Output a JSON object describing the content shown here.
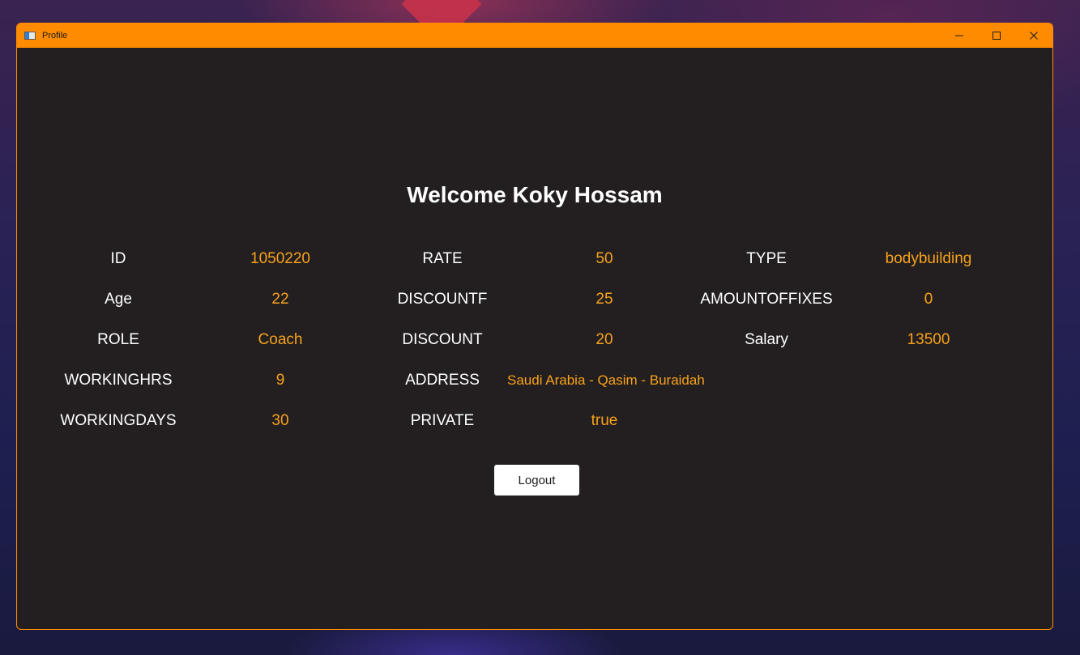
{
  "window": {
    "title": "Profile",
    "controls": {
      "minimize_icon": "minimize-icon",
      "maximize_icon": "maximize-icon",
      "close_icon": "close-icon"
    },
    "accent_color": "#ff8c00",
    "background_color": "#231f20"
  },
  "profile": {
    "welcome": "Welcome Koky Hossam",
    "value_color": "#f7a21b",
    "fields": {
      "id": {
        "label": "ID",
        "value": "1050220"
      },
      "age": {
        "label": "Age",
        "value": "22"
      },
      "role": {
        "label": "ROLE",
        "value": "Coach"
      },
      "workinghrs": {
        "label": "WORKINGHRS",
        "value": "9"
      },
      "workingdays": {
        "label": "WORKINGDAYS",
        "value": "30"
      },
      "rate": {
        "label": "RATE",
        "value": "50"
      },
      "discountf": {
        "label": "DISCOUNTF",
        "value": "25"
      },
      "discount": {
        "label": "DISCOUNT",
        "value": "20"
      },
      "address": {
        "label": "ADDRESS",
        "value": "Saudi Arabia - Qasim - Buraidah"
      },
      "private": {
        "label": "PRIVATE",
        "value": "true"
      },
      "type": {
        "label": "TYPE",
        "value": "bodybuilding"
      },
      "amountoffixes": {
        "label": "AMOUNTOFFIXES",
        "value": "0"
      },
      "salary": {
        "label": "Salary",
        "value": "13500"
      }
    },
    "logout_label": "Logout"
  }
}
